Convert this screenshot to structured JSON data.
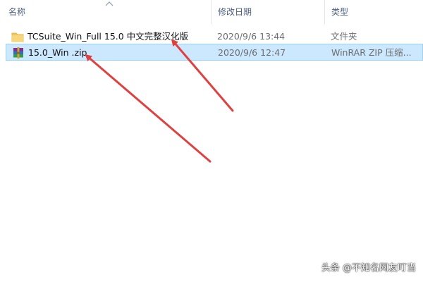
{
  "header": {
    "name_label": "名称",
    "date_label": "修改日期",
    "type_label": "类型"
  },
  "files": [
    {
      "name": "TCSuite_Win_Full 15.0 中文完整汉化版",
      "date": "2020/9/6 13:44",
      "type": "文件夹",
      "icon": "folder-icon",
      "selected": false
    },
    {
      "name": "15.0_Win .zip",
      "date": "2020/9/6 12:47",
      "type": "WinRAR ZIP 压缩...",
      "icon": "winrar-zip-icon",
      "selected": true
    }
  ],
  "watermark": "头条 @不知名网友叮当",
  "colors": {
    "selection_bg": "#cce8ff",
    "selection_border": "#99d1ff",
    "arrow": "#e0403f",
    "folder": "#f2c55c"
  }
}
